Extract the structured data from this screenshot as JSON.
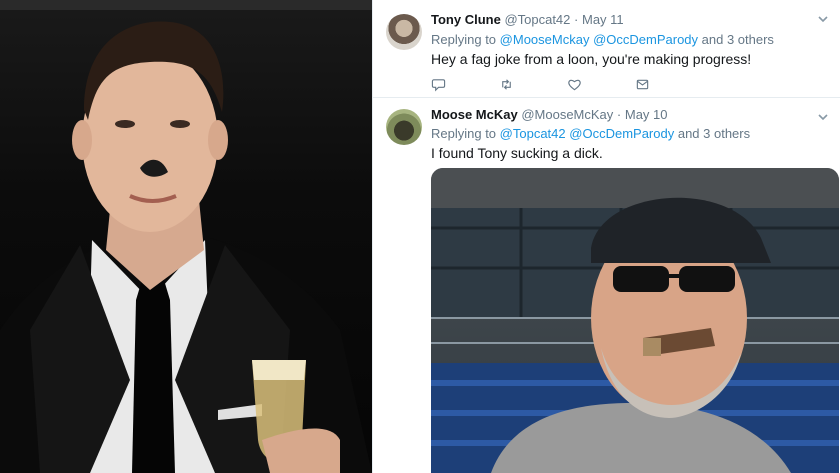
{
  "tweets": [
    {
      "name": "Tony Clune",
      "handle": "@Topcat42",
      "sep": "·",
      "date": "May 11",
      "replying_prefix": "Replying to",
      "mentions": [
        "@MooseMckay",
        "@OccDemParody"
      ],
      "others": "and 3 others",
      "text": "Hey a fag joke from a loon, you're making progress!"
    },
    {
      "name": "Moose McKay",
      "handle": "@MooseMcKay",
      "sep": "·",
      "date": "May 10",
      "replying_prefix": "Replying to",
      "mentions": [
        "@Topcat42",
        "@OccDemParody"
      ],
      "others": "and 3 others",
      "text": "I found Tony sucking a dick."
    }
  ],
  "colors": {
    "link": "#1b95e0",
    "secondary_text": "#657786",
    "primary_text": "#14171a",
    "divider": "#e6ecf0"
  },
  "icons": {
    "reply": "reply-icon",
    "retweet": "retweet-icon",
    "like": "heart-icon",
    "dm": "envelope-icon",
    "menu": "chevron-down-icon"
  }
}
